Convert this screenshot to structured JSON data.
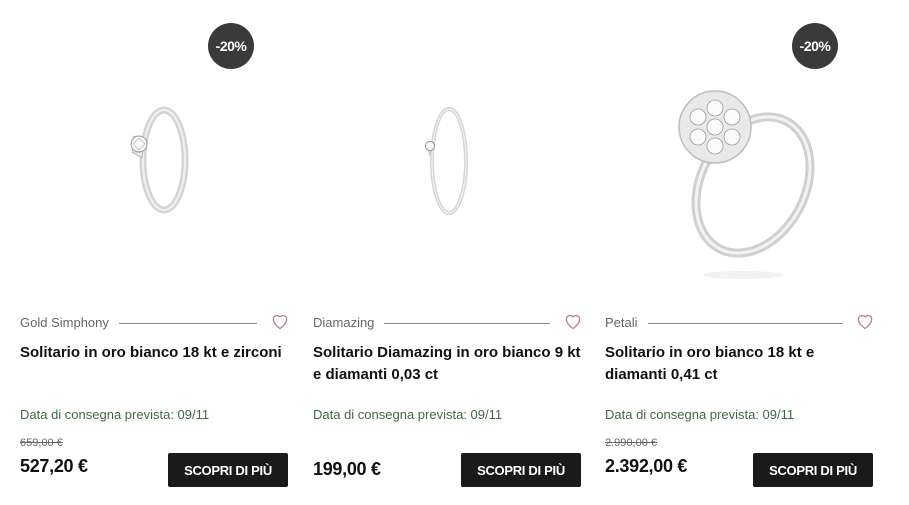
{
  "products": [
    {
      "discount_badge": "-20%",
      "brand": "Gold Simphony",
      "title": "Solitario in oro bianco 18 kt e zirconi",
      "delivery": "Data di consegna prevista: 09/11",
      "old_price": "659,00 €",
      "price": "527,20 €",
      "cta": "SCOPRI DI PIÙ",
      "image": "solitaire-ring-image"
    },
    {
      "brand": "Diamazing",
      "title": "Solitario Diamazing in oro bianco 9 kt e diamanti 0,03 ct",
      "delivery": "Data di consegna prevista: 09/11",
      "price": "199,00 €",
      "cta": "SCOPRI DI PIÙ",
      "image": "thin-solitaire-ring-image"
    },
    {
      "discount_badge": "-20%",
      "brand": "Petali",
      "title": "Solitario in oro bianco 18 kt e diamanti 0,41 ct",
      "delivery": "Data di consegna prevista: 09/11",
      "old_price": "2.990,00 €",
      "price": "2.392,00 €",
      "cta": "SCOPRI DI PIÙ",
      "image": "flower-cluster-ring-image"
    }
  ],
  "colors": {
    "badge_bg": "#3a3a3a",
    "heart": "#b5828a",
    "delivery_text": "#3d6b3d",
    "button_bg": "#1a1a1a"
  },
  "icons": [
    "heart-icon"
  ]
}
